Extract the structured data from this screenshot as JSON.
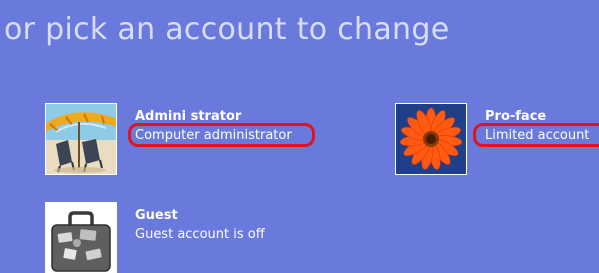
{
  "heading": "or pick an account to change",
  "accounts": [
    {
      "name": "Admini strator",
      "description": "Computer administrator",
      "picture": "beach-chairs-picture"
    },
    {
      "name": "Pro-face",
      "description": "Limited account",
      "picture": "orange-flower-picture"
    },
    {
      "name": "Guest",
      "description": "Guest account is off",
      "picture": "suitcase-picture"
    }
  ],
  "colors": {
    "panel_background": "#6a79dc",
    "heading_text": "#d8ddfa",
    "highlight_ring": "#e0141e"
  }
}
